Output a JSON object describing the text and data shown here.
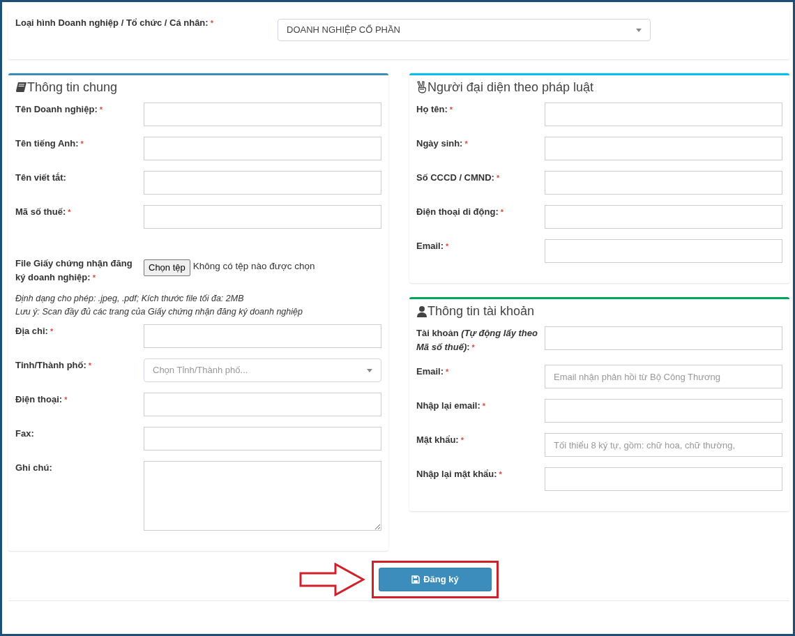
{
  "business_type": {
    "label": "Loại hình Doanh nghiệp / Tổ chức / Cá nhân:",
    "required_mark": "*",
    "value": "DOANH NGHIỆP CỔ PHẦN"
  },
  "sections": [
    {
      "title": "Thông tin chung",
      "color": "#3c8dbc",
      "fields": [
        {
          "kind": "text",
          "label": "Tên Doanh nghiệp:",
          "required_mark": "*"
        },
        {
          "kind": "text",
          "label": "Tên tiếng Anh:",
          "required_mark": "*"
        },
        {
          "kind": "text",
          "label": "Tên viết tắt:"
        },
        {
          "kind": "text",
          "label": "Mã số thuế:",
          "required_mark": "*"
        },
        {
          "kind": "file",
          "label": "File Giấy chứng nhận đăng ký doanh nghiệp:",
          "required_mark": "*",
          "button": "Chọn tệp",
          "status": "Không có tệp nào được chọn"
        },
        {
          "kind": "note",
          "lines": [
            "Định dạng cho phép: .jpeg, .pdf; Kích thước file tối đa: 2MB",
            "Lưu ý: Scan đầy đủ các trang của Giấy chứng nhận đăng ký doanh nghiệp"
          ]
        },
        {
          "kind": "text",
          "label": "Địa chỉ:",
          "required_mark": "*"
        },
        {
          "kind": "select",
          "label": "Tỉnh/Thành phố:",
          "required_mark": "*",
          "placeholder": "Chọn Tỉnh/Thành phố..."
        },
        {
          "kind": "text",
          "label": "Điện thoại:",
          "required_mark": "*"
        },
        {
          "kind": "text",
          "label": "Fax:"
        },
        {
          "kind": "textarea",
          "label": "Ghi chú:"
        }
      ]
    },
    {
      "title": "Người đại diện theo pháp luật",
      "color": "#00c0ef",
      "fields": [
        {
          "kind": "text",
          "label": "Họ tên:",
          "required_mark": "*"
        },
        {
          "kind": "text",
          "label": "Ngày sinh:",
          "required_mark": "*"
        },
        {
          "kind": "text",
          "label": "Số CCCD / CMND:",
          "required_mark": "*"
        },
        {
          "kind": "text",
          "label": "Điện thoại di động:",
          "required_mark": "*"
        },
        {
          "kind": "text",
          "label": "Email:",
          "required_mark": "*"
        }
      ]
    },
    {
      "title": "Thông tin tài khoản",
      "color": "#00a65a",
      "fields": [
        {
          "kind": "text",
          "label": "Tài khoản *(Tự động lấy theo Mã số thuế)*:",
          "required_mark": "*"
        },
        {
          "kind": "text",
          "label": "Email:",
          "required_mark": "*",
          "placeholder": "Email nhận phản hồi từ Bộ Công Thương"
        },
        {
          "kind": "text",
          "label": "Nhập lại email:",
          "required_mark": "*"
        },
        {
          "kind": "text",
          "label": "Mật khẩu:",
          "required_mark": "*",
          "placeholder": "Tối thiểu 8 ký tự, gồm: chữ hoa, chữ thường,"
        },
        {
          "kind": "text",
          "label": "Nhập lại mật khẩu:",
          "required_mark": "*"
        }
      ]
    }
  ],
  "submit": {
    "label": "Đăng ký"
  }
}
